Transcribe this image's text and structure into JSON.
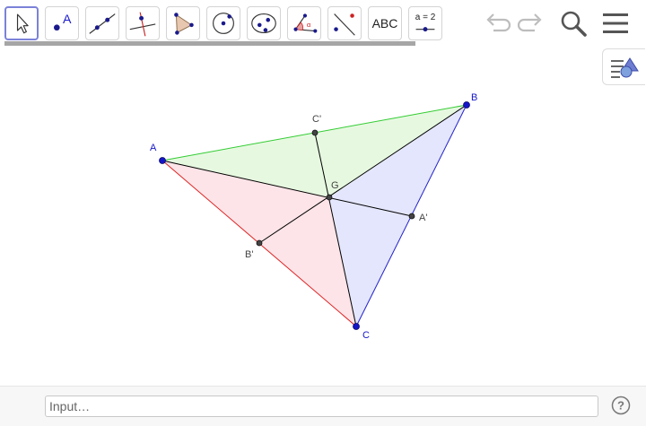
{
  "toolbar": {
    "tools": [
      {
        "name": "move",
        "icon": "cursor-arrow-icon",
        "selected": true
      },
      {
        "name": "point",
        "icon": "point-icon",
        "letter": "A"
      },
      {
        "name": "line",
        "icon": "line-through-points-icon"
      },
      {
        "name": "perpendicular-line",
        "icon": "perpendicular-line-icon"
      },
      {
        "name": "polygon",
        "icon": "polygon-icon"
      },
      {
        "name": "circle",
        "icon": "circle-with-center-icon"
      },
      {
        "name": "ellipse",
        "icon": "ellipse-icon"
      },
      {
        "name": "angle",
        "icon": "angle-icon",
        "letter": "α"
      },
      {
        "name": "reflect",
        "icon": "reflect-about-line-icon"
      },
      {
        "name": "text",
        "icon": "text-icon",
        "label": "ABC"
      },
      {
        "name": "slider",
        "icon": "slider-icon",
        "label": "a = 2"
      }
    ],
    "undo_icon": "undo-icon",
    "redo_icon": "redo-icon",
    "search_icon": "search-icon",
    "menu_icon": "hamburger-menu-icon"
  },
  "style_bar_toggle": {
    "icon": "style-bar-toggle-icon"
  },
  "graphics": {
    "points": {
      "A": {
        "label": "A",
        "color": "#1515c8"
      },
      "B": {
        "label": "B",
        "color": "#1515c8"
      },
      "C": {
        "label": "C",
        "color": "#1515c8"
      },
      "A_prime": {
        "label": "A'",
        "color": "#444444"
      },
      "B_prime": {
        "label": "B'",
        "color": "#444444"
      },
      "C_prime": {
        "label": "C'",
        "color": "#444444"
      },
      "G": {
        "label": "G",
        "color": "#444444"
      }
    },
    "colors": {
      "green_side": "#33cc33",
      "red_side": "#dd2222",
      "blue_side": "#2222cc",
      "green_fill": "#e6f9e0",
      "red_fill": "#fde4e8",
      "blue_fill": "#e4e6fd",
      "median": "#000000"
    }
  },
  "input_bar": {
    "placeholder": "Input…",
    "help_icon": "help-icon"
  }
}
